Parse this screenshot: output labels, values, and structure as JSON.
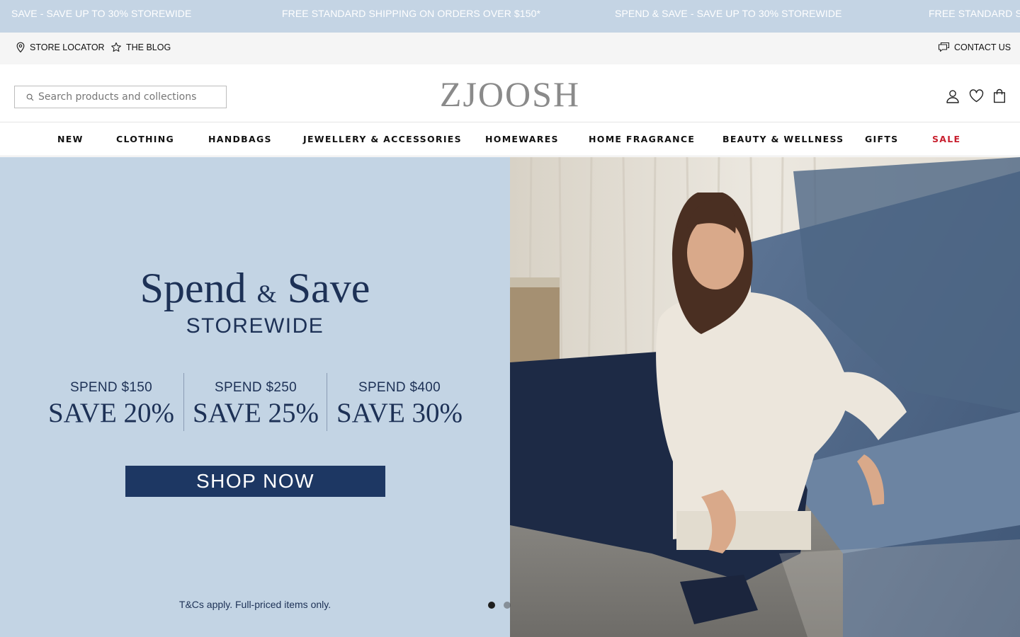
{
  "announcement_bar": {
    "messages": [
      "SAVE - SAVE UP TO 30% STOREWIDE",
      "FREE STANDARD SHIPPING ON ORDERS OVER $150*",
      "SPEND & SAVE - SAVE UP TO 30% STOREWIDE",
      "FREE STANDARD S"
    ],
    "background": "#c4d4e4"
  },
  "utility_bar": {
    "store_locator": "STORE LOCATOR",
    "blog": "THE BLOG",
    "contact": "CONTACT US",
    "icons": [
      "map-pin-icon",
      "star-icon",
      "chat-icon"
    ]
  },
  "header": {
    "search_placeholder": "Search products and collections",
    "logo": "ZJOOSH",
    "icons": [
      "account-icon",
      "wishlist-heart-icon",
      "shopping-bag-icon"
    ]
  },
  "nav": {
    "items": [
      "NEW",
      "CLOTHING",
      "HANDBAGS",
      "JEWELLERY & ACCESSORIES",
      "HOMEWARES",
      "HOME FRAGRANCE",
      "BEAUTY & WELLNESS",
      "GIFTS",
      "SALE"
    ],
    "sale_color": "#c8202f"
  },
  "hero": {
    "headline_part1": "Spend",
    "headline_amp": "&",
    "headline_part2": "Save",
    "subheadline": "STOREWIDE",
    "tiers": [
      {
        "spend": "SPEND $150",
        "save": "SAVE 20%"
      },
      {
        "spend": "SPEND $250",
        "save": "SAVE 25%"
      },
      {
        "spend": "SPEND $400",
        "save": "SAVE 30%"
      }
    ],
    "cta": "SHOP NOW",
    "terms": "T&Cs apply. Full-priced items only.",
    "text_color": "#1d3156",
    "panel_color": "#c3d4e4",
    "button_color": "#1d3763",
    "slides_total": 2,
    "active_slide": 1
  }
}
